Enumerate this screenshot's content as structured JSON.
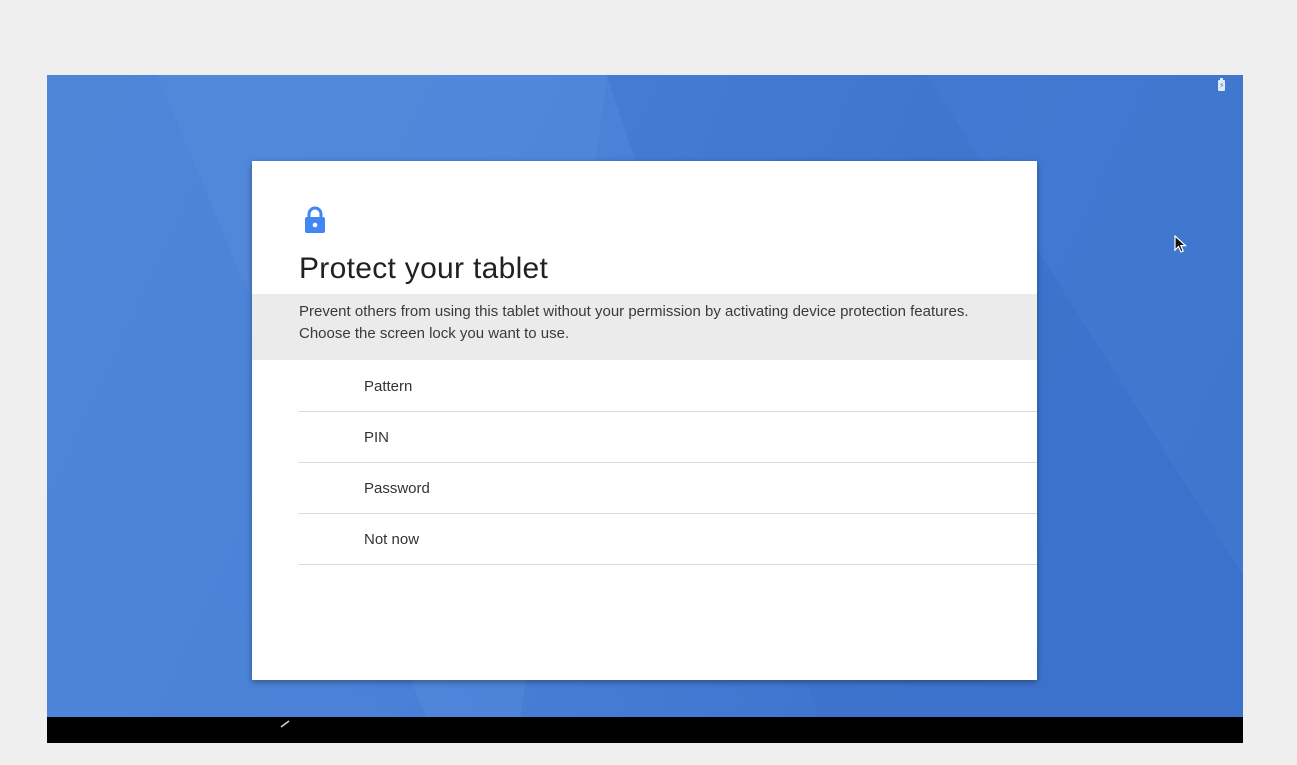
{
  "dialog": {
    "icon": "lock-icon",
    "title": "Protect your tablet",
    "description": "Prevent others from using this tablet without your permission by activating device protection features. Choose the screen lock you want to use.",
    "options": [
      {
        "label": "Pattern"
      },
      {
        "label": "PIN"
      },
      {
        "label": "Password"
      },
      {
        "label": "Not now"
      }
    ]
  },
  "status_bar": {
    "icon": "battery-charging-icon"
  },
  "nav_bar": {
    "back_icon": "back-icon"
  },
  "colors": {
    "accent": "#4285f4",
    "wallpaper": "#4a80d6",
    "card": "#ffffff",
    "description_band": "#ebebeb",
    "nav_bar": "#000000"
  }
}
